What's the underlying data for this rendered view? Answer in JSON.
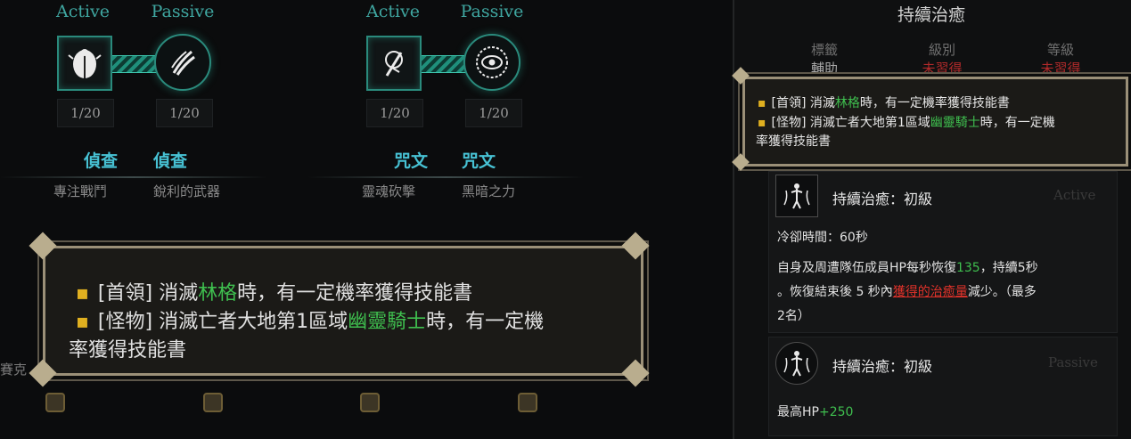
{
  "skill_tree": {
    "groups": [
      {
        "active_label": "Active",
        "passive_label": "Passive",
        "active_level": "1/20",
        "passive_level": "1/20",
        "active_category": "偵查",
        "passive_category": "偵查",
        "active_name": "專注戰鬥",
        "passive_name": "銳利的武器"
      },
      {
        "active_label": "Active",
        "passive_label": "Passive",
        "active_level": "1/20",
        "passive_level": "1/20",
        "active_category": "咒文",
        "passive_category": "咒文",
        "active_name": "靈魂砍擊",
        "passive_name": "黑暗之力"
      }
    ],
    "side_text": "賽克"
  },
  "big_tooltip": {
    "line1_prefix": "[首領] 消滅",
    "line1_green": "林格",
    "line1_suffix": "時，有一定機率獲得技能書",
    "line2_prefix": "[怪物] 消滅亡者大地第1區域",
    "line2_green": "幽靈騎士",
    "line2_suffix": "時，有一定機",
    "line3": "率獲得技能書"
  },
  "right_panel": {
    "title": "持續治癒",
    "columns": [
      {
        "header": "標籤",
        "value": "輔助",
        "status": "normal"
      },
      {
        "header": "級別",
        "value": "未習得",
        "status": "red"
      },
      {
        "header": "等級",
        "value": "未習得",
        "status": "red"
      }
    ],
    "drop_info": {
      "line1_prefix": "[首領] 消滅",
      "line1_green": "林格",
      "line1_suffix": "時，有一定機率獲得技能書",
      "line2_prefix": "[怪物] 消滅亡者大地第1區域",
      "line2_green": "幽靈騎士",
      "line2_suffix": "時，有一定機",
      "line3": "率獲得技能書"
    },
    "active_skill": {
      "name": "持續治癒：初級",
      "type_label": "Active",
      "cooldown": "冷卻時間：60秒",
      "desc1_prefix": "自身及周遭隊伍成員HP每秒恢復",
      "desc1_green": "135",
      "desc1_suffix": "，持續5秒",
      "desc2_prefix": "。恢復結束後 5 秒內",
      "desc2_red": "獲得的治癒量",
      "desc2_suffix": "減少。（最多",
      "desc3": "2名）"
    },
    "passive_skill": {
      "name": "持續治癒：初級",
      "type_label": "Passive",
      "stat_prefix": "最高HP",
      "stat_green": "+250"
    }
  },
  "colors": {
    "accent_teal": "#2a8a7c",
    "category_blue": "#47c2d4",
    "highlight_green": "#3fbf4f",
    "bullet_yellow": "#e0b020",
    "warning_red": "#e0322a"
  }
}
